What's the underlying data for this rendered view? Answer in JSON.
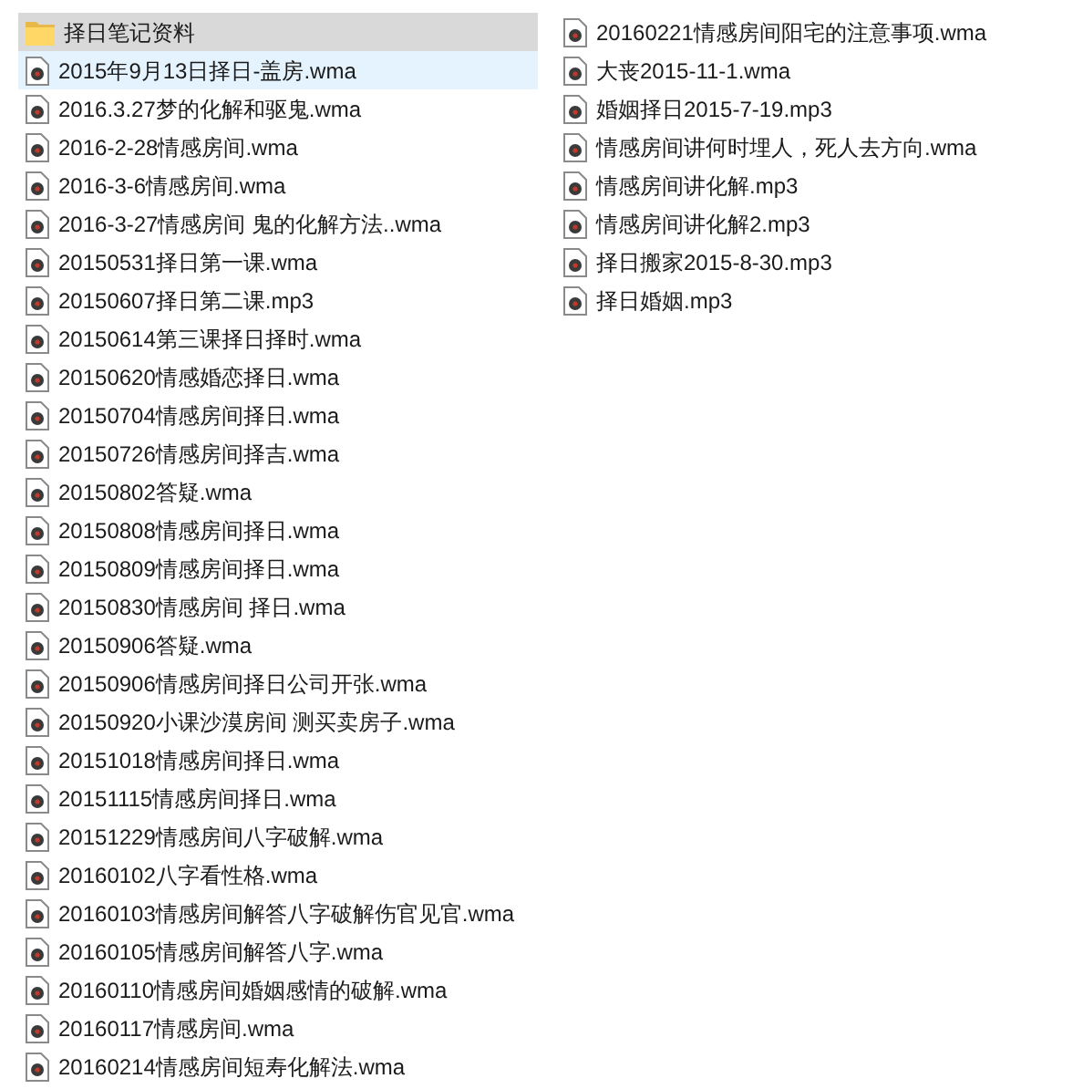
{
  "files": [
    {
      "kind": "folder",
      "name": "择日笔记资料",
      "selected": true,
      "hovered": false
    },
    {
      "kind": "audio",
      "name": "2015年9月13日择日-盖房.wma",
      "selected": false,
      "hovered": true
    },
    {
      "kind": "audio",
      "name": "2016.3.27梦的化解和驱鬼.wma",
      "selected": false,
      "hovered": false
    },
    {
      "kind": "audio",
      "name": "2016-2-28情感房间.wma",
      "selected": false,
      "hovered": false
    },
    {
      "kind": "audio",
      "name": "2016-3-6情感房间.wma",
      "selected": false,
      "hovered": false
    },
    {
      "kind": "audio",
      "name": "2016-3-27情感房间 鬼的化解方法..wma",
      "selected": false,
      "hovered": false
    },
    {
      "kind": "audio",
      "name": "20150531择日第一课.wma",
      "selected": false,
      "hovered": false
    },
    {
      "kind": "audio",
      "name": "20150607择日第二课.mp3",
      "selected": false,
      "hovered": false
    },
    {
      "kind": "audio",
      "name": "20150614第三课择日择时.wma",
      "selected": false,
      "hovered": false
    },
    {
      "kind": "audio",
      "name": "20150620情感婚恋择日.wma",
      "selected": false,
      "hovered": false
    },
    {
      "kind": "audio",
      "name": "20150704情感房间择日.wma",
      "selected": false,
      "hovered": false
    },
    {
      "kind": "audio",
      "name": "20150726情感房间择吉.wma",
      "selected": false,
      "hovered": false
    },
    {
      "kind": "audio",
      "name": "20150802答疑.wma",
      "selected": false,
      "hovered": false
    },
    {
      "kind": "audio",
      "name": "20150808情感房间择日.wma",
      "selected": false,
      "hovered": false
    },
    {
      "kind": "audio",
      "name": "20150809情感房间择日.wma",
      "selected": false,
      "hovered": false
    },
    {
      "kind": "audio",
      "name": "20150830情感房间 择日.wma",
      "selected": false,
      "hovered": false
    },
    {
      "kind": "audio",
      "name": "20150906答疑.wma",
      "selected": false,
      "hovered": false
    },
    {
      "kind": "audio",
      "name": "20150906情感房间择日公司开张.wma",
      "selected": false,
      "hovered": false
    },
    {
      "kind": "audio",
      "name": "20150920小课沙漠房间 测买卖房子.wma",
      "selected": false,
      "hovered": false
    },
    {
      "kind": "audio",
      "name": "20151018情感房间择日.wma",
      "selected": false,
      "hovered": false
    },
    {
      "kind": "audio",
      "name": "20151115情感房间择日.wma",
      "selected": false,
      "hovered": false
    },
    {
      "kind": "audio",
      "name": "20151229情感房间八字破解.wma",
      "selected": false,
      "hovered": false
    },
    {
      "kind": "audio",
      "name": "20160102八字看性格.wma",
      "selected": false,
      "hovered": false
    },
    {
      "kind": "audio",
      "name": "20160103情感房间解答八字破解伤官见官.wma",
      "selected": false,
      "hovered": false
    },
    {
      "kind": "audio",
      "name": "20160105情感房间解答八字.wma",
      "selected": false,
      "hovered": false
    },
    {
      "kind": "audio",
      "name": "20160110情感房间婚姻感情的破解.wma",
      "selected": false,
      "hovered": false
    },
    {
      "kind": "audio",
      "name": "20160117情感房间.wma",
      "selected": false,
      "hovered": false
    },
    {
      "kind": "audio",
      "name": "20160214情感房间短寿化解法.wma",
      "selected": false,
      "hovered": false
    },
    {
      "kind": "audio",
      "name": "20160221情感房间阳宅的注意事项.wma",
      "selected": false,
      "hovered": false
    },
    {
      "kind": "audio",
      "name": "大丧2015-11-1.wma",
      "selected": false,
      "hovered": false
    },
    {
      "kind": "audio",
      "name": "婚姻择日2015-7-19.mp3",
      "selected": false,
      "hovered": false
    },
    {
      "kind": "audio",
      "name": "情感房间讲何时埋人，死人去方向.wma",
      "selected": false,
      "hovered": false
    },
    {
      "kind": "audio",
      "name": "情感房间讲化解.mp3",
      "selected": false,
      "hovered": false
    },
    {
      "kind": "audio",
      "name": "情感房间讲化解2.mp3",
      "selected": false,
      "hovered": false
    },
    {
      "kind": "audio",
      "name": "择日搬家2015-8-30.mp3",
      "selected": false,
      "hovered": false
    },
    {
      "kind": "audio",
      "name": "择日婚姻.mp3",
      "selected": false,
      "hovered": false
    }
  ]
}
